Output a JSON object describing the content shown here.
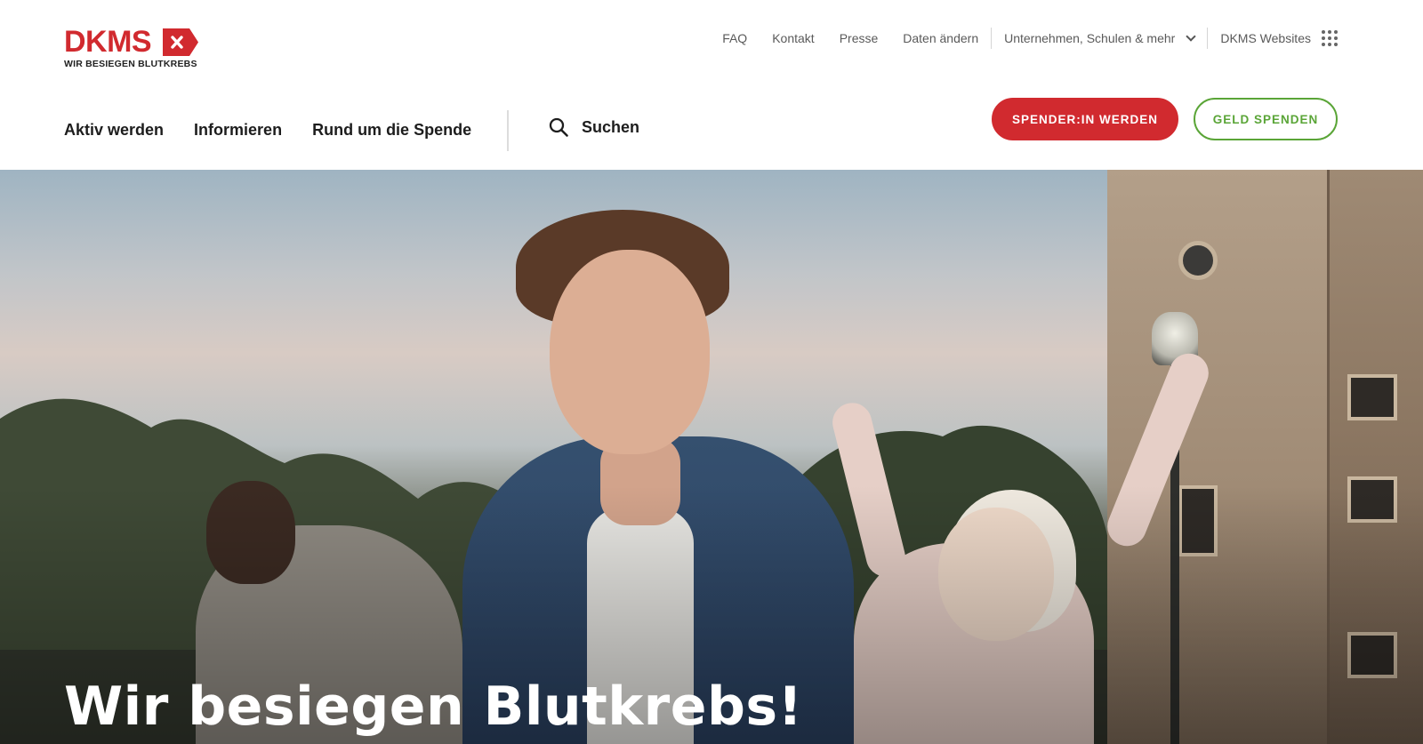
{
  "brand": {
    "name": "DKMS",
    "tagline": "WIR BESIEGEN BLUTKREBS",
    "color_primary": "#d12a2f",
    "color_secondary": "#5aa537"
  },
  "meta_nav": {
    "links": [
      "FAQ",
      "Kontakt",
      "Presse",
      "Daten ändern"
    ],
    "dropdown_label": "Unternehmen, Schulen & mehr",
    "dropdown_icon": "chevron-down-icon",
    "sites_label": "DKMS Websites",
    "sites_icon": "apps-grid-icon"
  },
  "main_nav": {
    "items": [
      "Aktiv werden",
      "Informieren",
      "Rund um die Spende"
    ],
    "search_label": "Suchen",
    "search_icon": "search-icon"
  },
  "cta": {
    "primary_label": "Spender:in werden",
    "secondary_label": "Geld spenden"
  },
  "hero": {
    "title": "Wir besiegen Blutkrebs!"
  }
}
